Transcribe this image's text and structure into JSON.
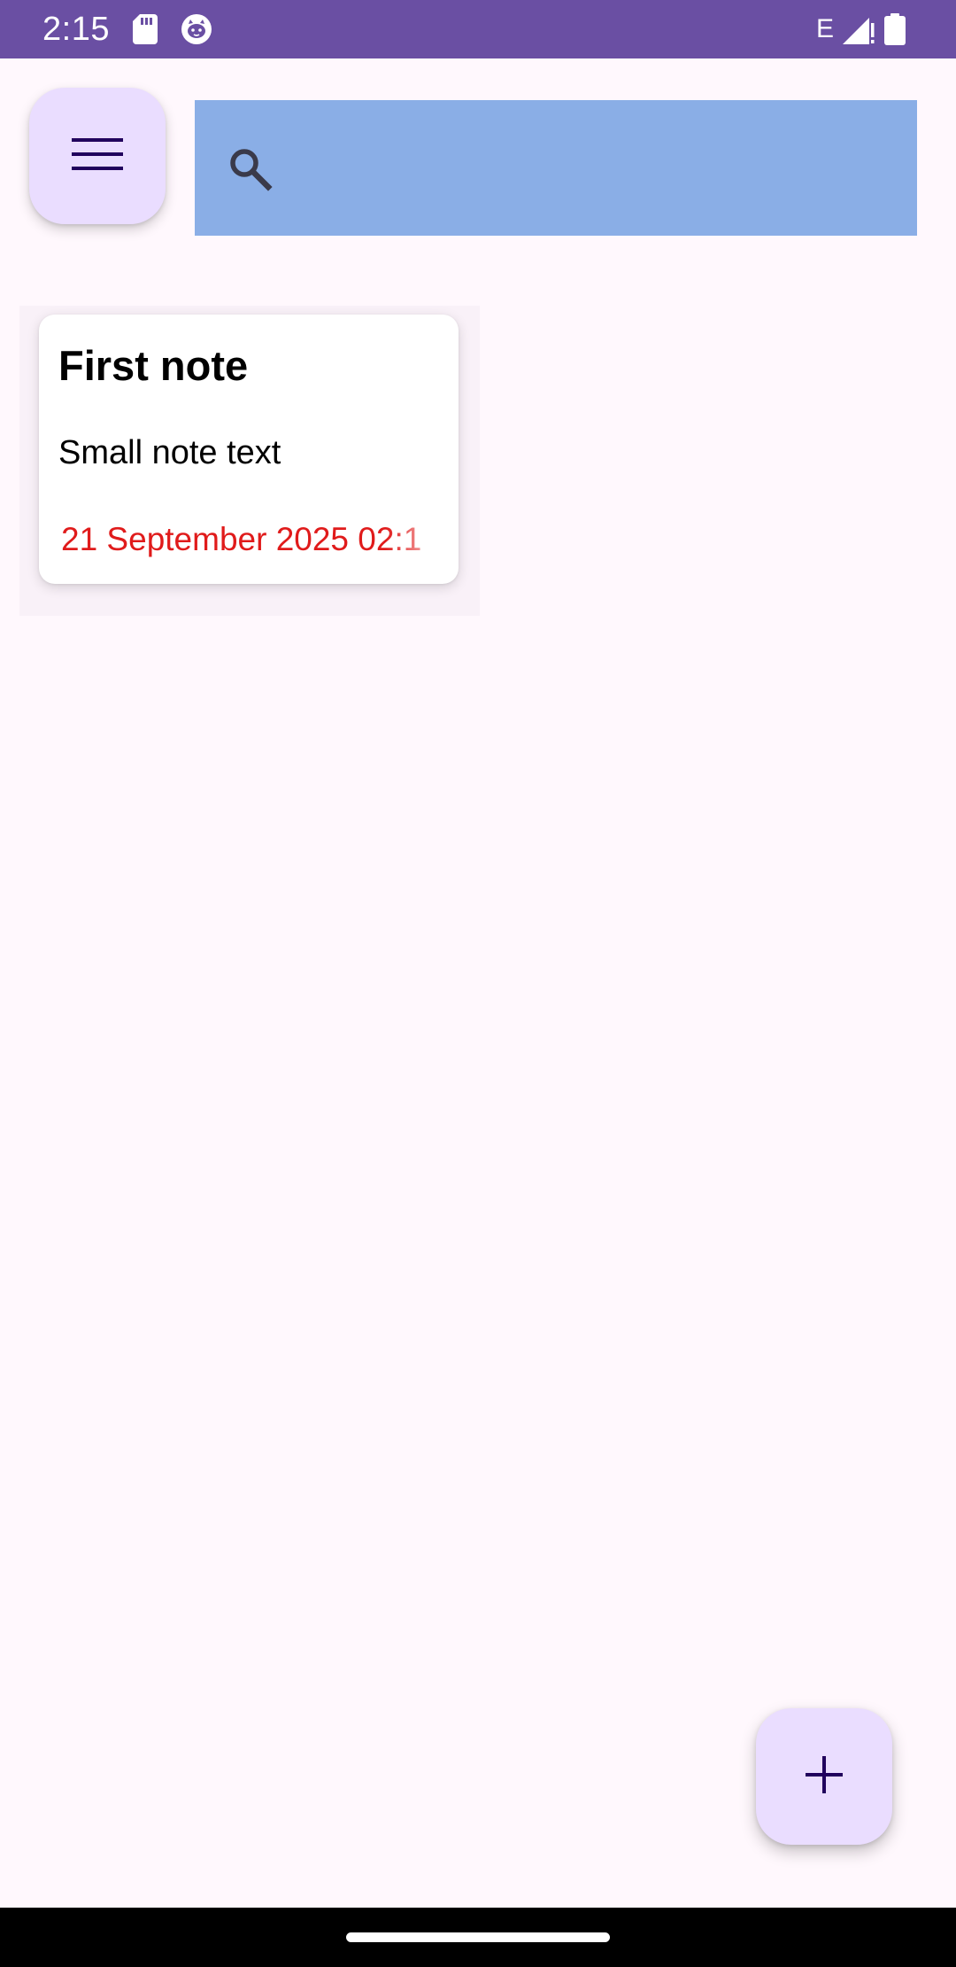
{
  "status_bar": {
    "time": "2:15",
    "network_type": "E",
    "icons": [
      "sd-card-icon",
      "cat-face-icon",
      "signal-icon",
      "battery-icon"
    ],
    "background_color": "#6A4FA3"
  },
  "toolbar": {
    "menu_icon": "hamburger-menu-icon",
    "search": {
      "icon": "search-icon",
      "value": "",
      "placeholder": ""
    },
    "search_bar_color": "#8AAEE6",
    "button_color": "#EADDFF"
  },
  "notes": [
    {
      "title": "First note",
      "text": "Small note text",
      "date": "21 September 2025 02:1"
    }
  ],
  "colors": {
    "date_text": "#E01B1B",
    "background": "#FFF8FD"
  },
  "fab": {
    "icon": "plus-icon"
  }
}
